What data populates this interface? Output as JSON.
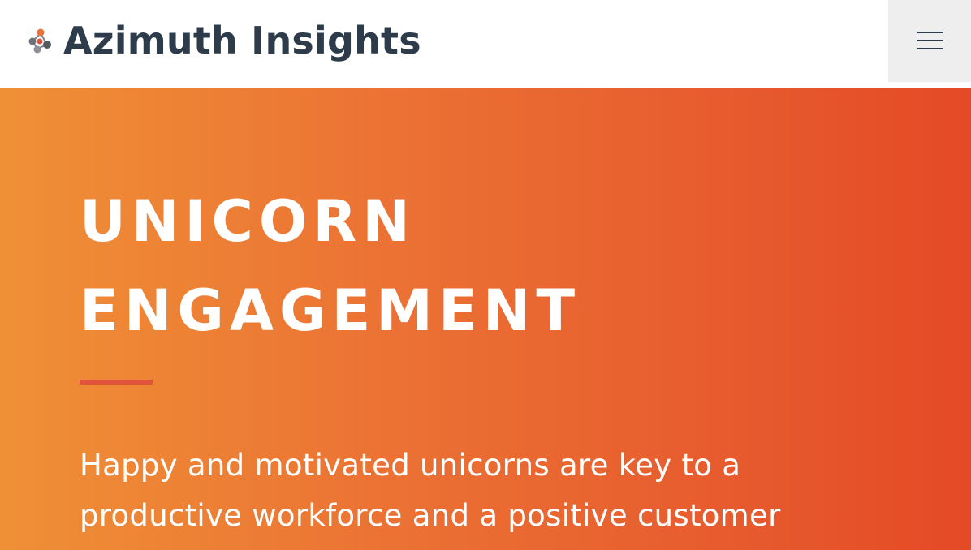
{
  "header": {
    "brand_name": "Azimuth Insights",
    "logo_icon": "molecule-dots-icon",
    "menu_icon": "hamburger-menu-icon"
  },
  "hero": {
    "title_line1": "UNICORN",
    "title_line2": "ENGAGEMENT",
    "description": "Happy and motivated unicorns are key to a productive workforce and a positive customer"
  },
  "colors": {
    "brand_text": "#2d3b4a",
    "gradient_start": "#ef9036",
    "gradient_end": "#e44a26",
    "divider": "#e0553a",
    "menu_background": "#eeeeee"
  }
}
